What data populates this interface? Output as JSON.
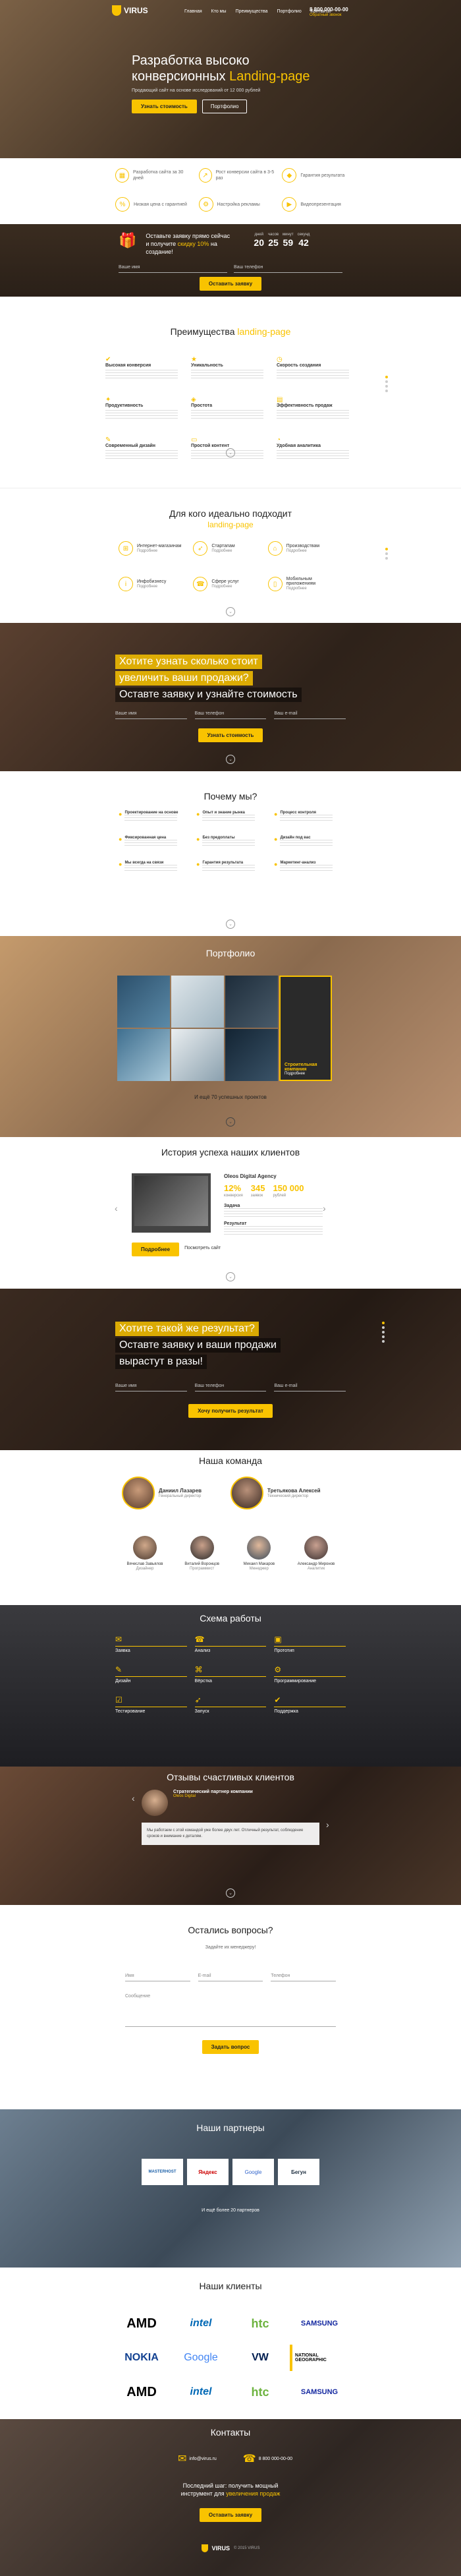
{
  "header": {
    "brand": "VIRUS",
    "nav": [
      "Главная",
      "Кто мы",
      "Преимущества",
      "Портфолио",
      "Контакты"
    ],
    "phone": "8 800 000-00-00",
    "callback": "Обратный звонок"
  },
  "hero": {
    "title_1": "Разработка высоко",
    "title_2": "конверсионных",
    "title_accent": "Landing-page",
    "subtitle": "Продающий сайт на основе исследований от 12 000 рублей",
    "btn_primary": "Узнать стоимость",
    "btn_secondary": "Портфолио"
  },
  "features": [
    {
      "icon": "calendar-icon",
      "text": "Разработка сайта за 30 дней"
    },
    {
      "icon": "chart-icon",
      "text": "Рост конверсии сайта в 3-5 раз"
    },
    {
      "icon": "tag-icon",
      "text": "Гарантия результата"
    },
    {
      "icon": "percent-icon",
      "text": "Низкая цена с гарантией"
    },
    {
      "icon": "gear-icon",
      "text": "Настройка рекламы"
    },
    {
      "icon": "play-icon",
      "text": "Видеопрезентация"
    }
  ],
  "timer": {
    "text_1": "Оставьте заявку прямо сейчас",
    "text_2": "и получите",
    "text_accent": "скидку 10%",
    "text_3": "на создание!",
    "labels": [
      "дней",
      "часов",
      "минут",
      "секунд"
    ],
    "values": [
      "20",
      "25",
      "59",
      "42"
    ],
    "field_name": "Ваше имя",
    "field_phone": "Ваш телефон",
    "button": "Оставить заявку"
  },
  "advantages": {
    "title": "Преимущества",
    "title_accent": "landing-page",
    "items": [
      "Высокая конверсия",
      "Уникальность",
      "Скорость создания",
      "Продуктивность",
      "Простота",
      "Эффективность продаж",
      "Современный дизайн",
      "Простой контент",
      "Удобная аналитика"
    ]
  },
  "audience": {
    "title": "Для кого идеально подходит",
    "title_accent": "landing-page",
    "items": [
      "Интернет-магазинам",
      "Стартапам",
      "Производствам",
      "Инфобизнесу",
      "Сфере услуг",
      "Мобильным приложениям"
    ],
    "more": "Подробнее"
  },
  "cta1": {
    "line1": "Хотите узнать сколько стоит",
    "line2": "увеличить ваши продажи?",
    "line3": "Оставте заявку и узнайте стоимость",
    "field_name": "Ваше имя",
    "field_phone": "Ваш телефон",
    "field_email": "Ваш e-mail",
    "button": "Узнать стоимость"
  },
  "why": {
    "title": "Почему мы?",
    "items": [
      "Проектирование на основе",
      "Опыт и знание рынка",
      "Процесс контроля",
      "Фиксированная цена",
      "Без предоплаты",
      "Дизайн под вас",
      "Мы всегда на связи",
      "Гарантия результата",
      "Маркетинг-анализ"
    ]
  },
  "portfolio": {
    "title": "Портфолио",
    "highlight_title": "Строительная компания",
    "highlight_link": "Подробнее",
    "footer": "И ещё 70 успешных проектов"
  },
  "cases": {
    "title": "История успеха наших клиентов",
    "client": "Oleos Digital Agency",
    "stats": [
      "12%",
      "345",
      "150 000"
    ],
    "stat_labels": [
      "конверсия",
      "заявок",
      "рублей"
    ],
    "task": "Задача",
    "result": "Результат",
    "btn": "Подробнее",
    "btn2": "Посмотреть сайт"
  },
  "cta2": {
    "line1": "Хотите такой же результат?",
    "line2": "Оставте заявку и ваши продажи",
    "line3": "вырастут в разы!",
    "field_name": "Ваше имя",
    "field_phone": "Ваш телефон",
    "field_email": "Ваш e-mail",
    "button": "Хочу получить результат"
  },
  "team": {
    "title": "Наша команда",
    "leads": [
      {
        "name": "Даниил Лазарев",
        "role": "Генеральный директор"
      },
      {
        "name": "Третьякова Алексей",
        "role": "Технический директор"
      }
    ],
    "members": [
      {
        "name": "Вячеслав Завьялов",
        "role": "Дизайнер"
      },
      {
        "name": "Виталий Воронцов",
        "role": "Программист"
      },
      {
        "name": "Михаил Макаров",
        "role": "Менеджер"
      },
      {
        "name": "Александр Миронов",
        "role": "Аналитик"
      }
    ]
  },
  "scheme": {
    "title": "Схема работы",
    "steps": [
      "Заявка",
      "Анализ",
      "Прототип",
      "Дизайн",
      "Вёрстка",
      "Программирование",
      "Тестирование",
      "Запуск",
      "Поддержка"
    ]
  },
  "reviews": {
    "title": "Отзывы счастливых клиентов",
    "author": "Стратегический партнер компании",
    "company": "Oleos Digital",
    "text": "Мы работаем с этой командой уже более двух лет. Отличный результат, соблюдение сроков и внимание к деталям."
  },
  "questions": {
    "title": "Остались вопросы?",
    "subtitle": "Задайте их менеджеру!",
    "field_name": "Имя",
    "field_email": "E-mail",
    "field_phone": "Телефон",
    "field_message": "Сообщение",
    "button": "Задать вопрос"
  },
  "partners": {
    "title": "Наши партнеры",
    "logos": [
      "MASTERHOST",
      "Яндекс",
      "Google",
      "Бегун"
    ],
    "footer": "И ещё более 20 партнеров"
  },
  "clients": {
    "title": "Наши клиенты",
    "logos": [
      "AMD",
      "intel",
      "htc",
      "SAMSUNG",
      "NOKIA",
      "Google",
      "VW",
      "NATIONAL GEOGRAPHIC",
      "AMD",
      "intel",
      "htc",
      "SAMSUNG"
    ]
  },
  "contacts": {
    "title": "Контакты",
    "email": "info@virus.ru",
    "phone": "8 800 000-00-00",
    "promo_1": "Последний шаг: получить мощный",
    "promo_2": "инструмент для",
    "promo_accent": "увеличения продаж",
    "button": "Оставить заявку",
    "copyright": "© 2015 VIRUS"
  }
}
